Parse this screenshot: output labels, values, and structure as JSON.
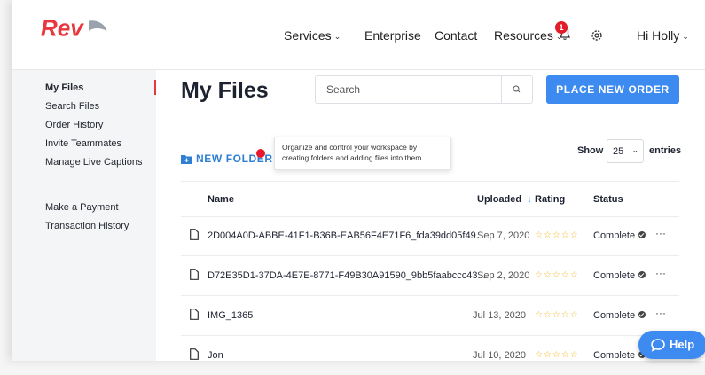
{
  "brand": {
    "logo_text": "Rev",
    "accent": "#e8373e",
    "primary": "#3d8bf0"
  },
  "topnav": {
    "services": "Services",
    "enterprise": "Enterprise",
    "contact": "Contact",
    "resources": "Resources",
    "notification_count": "1",
    "user_greeting": "Hi Holly"
  },
  "sidebar": {
    "items": [
      {
        "label": "My Files"
      },
      {
        "label": "Search Files"
      },
      {
        "label": "Order History"
      },
      {
        "label": "Invite Teammates"
      },
      {
        "label": "Manage Live Captions"
      },
      {
        "label": "Make a Payment"
      },
      {
        "label": "Transaction History"
      }
    ]
  },
  "main": {
    "title": "My Files",
    "search_placeholder": "Search",
    "place_order_label": "PLACE NEW ORDER",
    "new_folder_label": "NEW FOLDER",
    "tooltip_text": "Organize and control your workspace by creating folders and adding files into them.",
    "show_label": "Show",
    "entries_value": "25",
    "entries_label": "entries"
  },
  "table": {
    "columns": {
      "name": "Name",
      "uploaded": "Uploaded",
      "rating": "Rating",
      "status": "Status"
    },
    "rows": [
      {
        "name": "2D004A0D-ABBE-41F1-B36B-EAB56F4E71F6_fda39dd05f49...",
        "uploaded": "Sep 7, 2020",
        "rating_stars": "☆☆☆☆☆",
        "status": "Complete",
        "more": "···"
      },
      {
        "name": "D72E35D1-37DA-4E7E-8771-F49B30A91590_9bb5faabccc43...",
        "uploaded": "Sep 2, 2020",
        "rating_stars": "☆☆☆☆☆",
        "status": "Complete",
        "more": "···"
      },
      {
        "name": "IMG_1365",
        "uploaded": "Jul 13, 2020",
        "rating_stars": "☆☆☆☆☆",
        "status": "Complete",
        "more": "···"
      },
      {
        "name": "Jon",
        "uploaded": "Jul 10, 2020",
        "rating_stars": "☆☆☆☆☆",
        "status": "Complete",
        "more": "···"
      }
    ]
  },
  "help": {
    "label": "Help"
  }
}
